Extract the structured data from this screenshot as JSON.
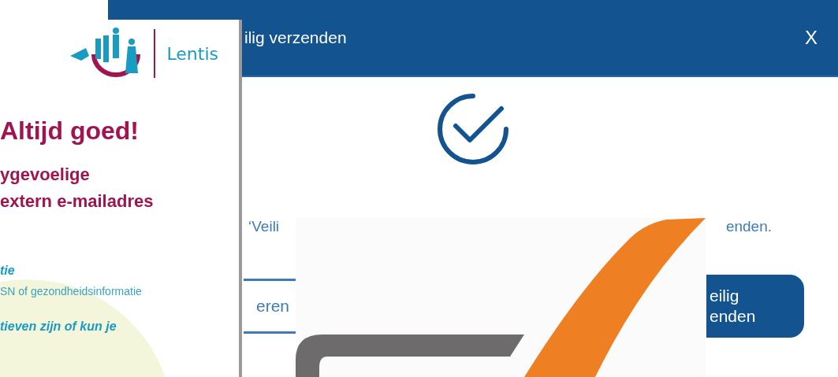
{
  "dialog": {
    "title": "ilig verzenden",
    "close": "X",
    "message": [
      "‘Veili",
      "enden."
    ],
    "buttons": [
      {
        "kind": "outline",
        "label": "eren"
      },
      {
        "kind": "primary",
        "label": "eilig\nenden"
      }
    ]
  },
  "flyer": {
    "logo_text": "Lentis",
    "headline": "Altijd goed!",
    "subheadline": "ygevoelige\nextern e-mailadres",
    "sections": [
      {
        "kind": "heading",
        "text": "tie"
      },
      {
        "kind": "body",
        "text": "SN of gezondheidsinformatie"
      },
      {
        "kind": "heading",
        "text": "tieven zijn of kun je"
      }
    ]
  }
}
